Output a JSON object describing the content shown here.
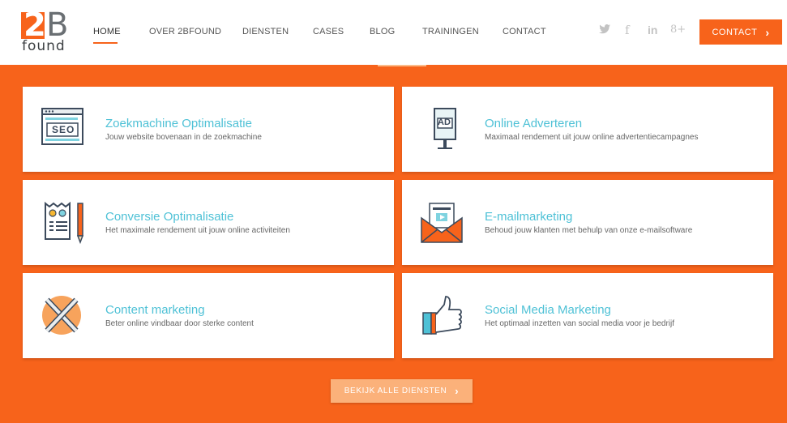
{
  "logo": {
    "mark": "2",
    "letter": "B",
    "word": "found"
  },
  "nav": [
    {
      "label": "HOME",
      "active": true
    },
    {
      "label": "OVER 2BFOUND"
    },
    {
      "label": "DIENSTEN"
    },
    {
      "label": "CASES"
    },
    {
      "label": "BLOG"
    },
    {
      "label": "TRAININGEN"
    },
    {
      "label": "CONTACT"
    }
  ],
  "social": {
    "twitter": "🐦",
    "facebook": "f",
    "linkedin": "in",
    "googleplus": "8+"
  },
  "header_cta": {
    "label": "CONTACT",
    "arrow": "›"
  },
  "services": [
    {
      "title": "Zoekmachine Optimalisatie",
      "subtitle": "Jouw website bovenaan in de zoekmachine",
      "icon": "seo-icon",
      "icon_text": "SEO"
    },
    {
      "title": "Online Adverteren",
      "subtitle": "Maximaal rendement uit jouw online advertentiecampagnes",
      "icon": "ad-icon",
      "icon_text": "AD"
    },
    {
      "title": "Conversie Optimalisatie",
      "subtitle": "Het maximale rendement uit jouw online activiteiten",
      "icon": "receipt-pencil-icon"
    },
    {
      "title": "E-mailmarketing",
      "subtitle": "Behoud jouw klanten met behulp van onze e-mailsoftware",
      "icon": "email-icon"
    },
    {
      "title": "Content marketing",
      "subtitle": "Beter online vindbaar door sterke content",
      "icon": "crossed-pencils-icon"
    },
    {
      "title": "Social Media Marketing",
      "subtitle": "Het optimaal inzetten van social media voor je bedrijf",
      "icon": "thumbs-up-icon"
    }
  ],
  "all_services_button": {
    "label": "BEKIJK ALLE DIENSTEN",
    "arrow": "›"
  },
  "colors": {
    "accent": "#f7631b",
    "title": "#4ec1d6",
    "button_light": "#fbb17a"
  }
}
